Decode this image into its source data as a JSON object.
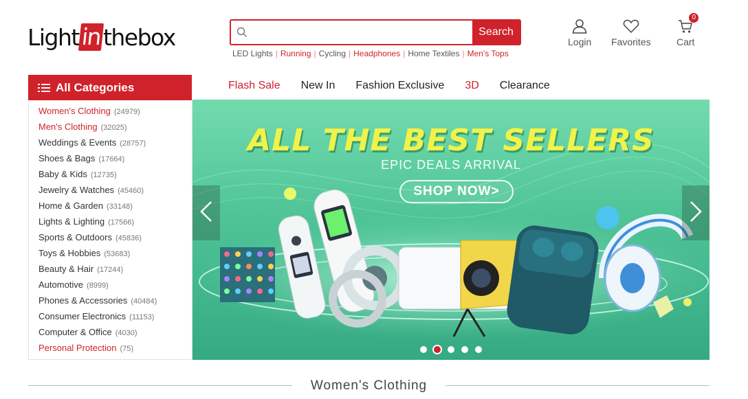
{
  "logo": {
    "prefix": "Light",
    "highlight": "in",
    "suffix": "thebox"
  },
  "search": {
    "placeholder": "",
    "value": "",
    "button_label": "Search"
  },
  "hot_searches": [
    {
      "label": "LED Lights",
      "red": false
    },
    {
      "label": "Running",
      "red": true
    },
    {
      "label": "Cycling",
      "red": false
    },
    {
      "label": "Headphones",
      "red": true
    },
    {
      "label": "Home Textiles",
      "red": false
    },
    {
      "label": "Men's Tops",
      "red": true
    }
  ],
  "user_actions": {
    "login": "Login",
    "favorites": "Favorites",
    "cart": "Cart",
    "cart_count": "0"
  },
  "categories": {
    "title": "All Categories",
    "items": [
      {
        "name": "Women's Clothing",
        "count": "(24979)",
        "red": true
      },
      {
        "name": "Men's Clothing",
        "count": "(32025)",
        "red": true
      },
      {
        "name": "Weddings & Events",
        "count": "(28757)",
        "red": false
      },
      {
        "name": "Shoes & Bags",
        "count": "(17664)",
        "red": false
      },
      {
        "name": "Baby & Kids",
        "count": "(12735)",
        "red": false
      },
      {
        "name": "Jewelry & Watches",
        "count": "(45460)",
        "red": false
      },
      {
        "name": "Home & Garden",
        "count": "(33148)",
        "red": false
      },
      {
        "name": "Lights & Lighting",
        "count": "(17566)",
        "red": false
      },
      {
        "name": "Sports & Outdoors",
        "count": "(45836)",
        "red": false
      },
      {
        "name": "Toys & Hobbies",
        "count": "(53683)",
        "red": false
      },
      {
        "name": "Beauty & Hair",
        "count": "(17244)",
        "red": false
      },
      {
        "name": "Automotive",
        "count": "(8999)",
        "red": false
      },
      {
        "name": "Phones & Accessories",
        "count": "(40484)",
        "red": false
      },
      {
        "name": "Consumer Electronics",
        "count": "(11153)",
        "red": false
      },
      {
        "name": "Computer & Office",
        "count": "(4030)",
        "red": false
      },
      {
        "name": "Personal Protection",
        "count": "(75)",
        "red": true
      }
    ]
  },
  "nav": [
    {
      "label": "Flash Sale",
      "red": true
    },
    {
      "label": "New In",
      "red": false
    },
    {
      "label": "Fashion Exclusive",
      "red": false
    },
    {
      "label": "3D",
      "red": true
    },
    {
      "label": "Clearance",
      "red": false
    }
  ],
  "banner": {
    "title": "ALL THE BEST SELLERS",
    "subtitle": "EPIC DEALS ARRIVAL",
    "cta": "SHOP NOW>",
    "slide_count": 5,
    "active_slide": 2
  },
  "section": {
    "title": "Women's Clothing"
  },
  "colors": {
    "brand_red": "#d0222a",
    "banner_green": "#4fc497",
    "title_yellow": "#f1f34a"
  }
}
